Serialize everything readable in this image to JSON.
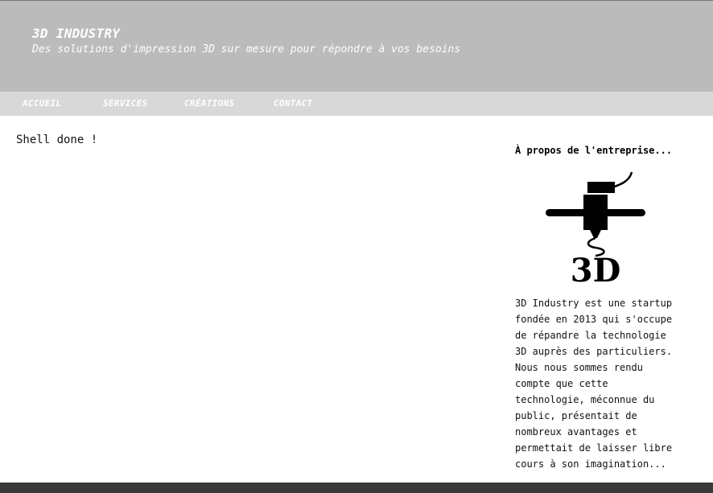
{
  "header": {
    "title": "3D INDUSTRY",
    "tagline": "Des solutions d'impression 3D sur mesure pour répondre à vos besoins"
  },
  "nav": {
    "items": [
      {
        "label": "ACCUEIL"
      },
      {
        "label": "SERVICES"
      },
      {
        "label": "CRÉATIONS"
      },
      {
        "label": "CONTACT"
      }
    ]
  },
  "main": {
    "text": "Shell done !"
  },
  "sidebar": {
    "title": "À propos de l'entreprise...",
    "logo_icon": "3d-printer-logo-icon",
    "lines": [
      "3D Industry est une startup",
      "fondée en 2013 qui s'occupe",
      "de répandre la technologie",
      "3D auprès des particuliers.",
      "Nous nous sommes rendu",
      "compte que cette",
      "technologie, méconnue du",
      "public, présentait de",
      "nombreux avantages et",
      "permettait de laisser libre",
      "cours à son imagination..."
    ]
  },
  "colors": {
    "header_bg": "#bbbbbb",
    "nav_bg": "#d8d8d8",
    "footer_bg": "#3a3a3a"
  }
}
